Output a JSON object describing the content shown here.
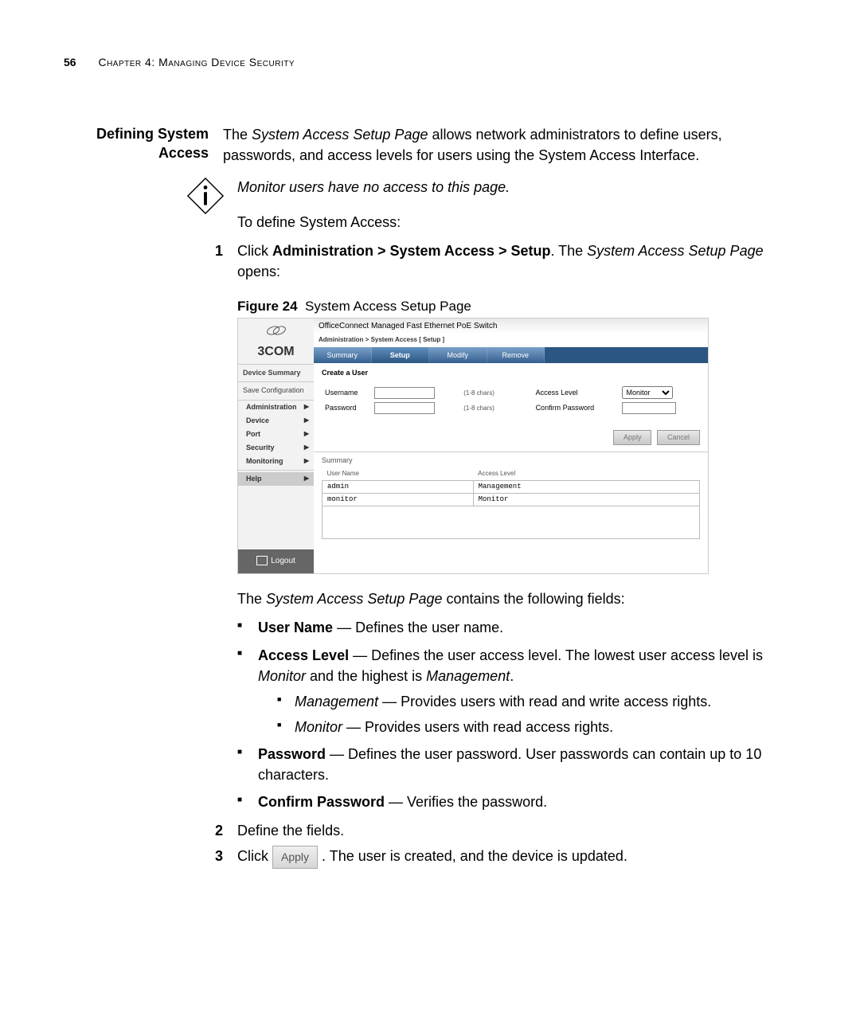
{
  "page": {
    "number": "56",
    "chapter": "Chapter 4: Managing Device Security"
  },
  "section_heading_l1": "Defining System",
  "section_heading_l2": "Access",
  "intro_text_1": "The ",
  "intro_em_1": "System Access Setup Page",
  "intro_text_2": " allows network administrators to define users, passwords, and access levels for users using the System Access Interface.",
  "note_text": "Monitor users have no access to this page.",
  "to_define": "To define System Access:",
  "step1_pre": "Click ",
  "step1_bold": "Administration > System Access > Setup",
  "step1_post": ". The ",
  "step1_em": "System Access Setup Page",
  "step1_end": " opens:",
  "figure_label": "Figure 24",
  "figure_title": "System Access Setup Page",
  "fig": {
    "brand": "3COM",
    "product": "OfficeConnect Managed Fast Ethernet PoE Switch",
    "breadcrumb": "Administration > System Access [ Setup ]",
    "sidebar": {
      "device_summary": "Device Summary",
      "save_config": "Save Configuration",
      "items": [
        "Administration",
        "Device",
        "Port",
        "Security",
        "Monitoring",
        "Help"
      ],
      "logout": "Logout"
    },
    "tabs": [
      "Summary",
      "Setup",
      "Modify",
      "Remove"
    ],
    "active_tab_index": 1,
    "form": {
      "section": "Create a User",
      "username_label": "Username",
      "username_hint": "(1-8 chars)",
      "password_label": "Password",
      "password_hint": "(1-8 chars)",
      "access_level_label": "Access Level",
      "access_level_value": "Monitor",
      "confirm_password_label": "Confirm Password",
      "apply": "Apply",
      "cancel": "Cancel"
    },
    "summary": {
      "heading": "Summary",
      "col_user": "User Name",
      "col_level": "Access Level",
      "rows": [
        {
          "user": "admin",
          "level": "Management"
        },
        {
          "user": "monitor",
          "level": "Monitor"
        }
      ]
    }
  },
  "after_fig_intro_1": "The ",
  "after_fig_intro_em": "System Access Setup Page",
  "after_fig_intro_2": " contains the following fields:",
  "bullets": {
    "user_name_b": "User Name",
    "user_name_rest": " — Defines the user name.",
    "access_level_b": "Access Level",
    "access_level_rest_1": " — Defines the user access level. The lowest user access level is ",
    "access_level_em1": "Monitor",
    "access_level_mid": " and the highest is ",
    "access_level_em2": "Management",
    "access_level_end": ".",
    "mgmt_em": "Management",
    "mgmt_rest": " — Provides users with read and write access rights.",
    "mon_em": "Monitor",
    "mon_rest": " — Provides users with read access rights.",
    "password_b": "Password",
    "password_rest": " — Defines the user password. User passwords can contain up to 10 characters.",
    "confirm_b": "Confirm Password",
    "confirm_rest": " — Verifies the password."
  },
  "step2": "Define the fields.",
  "step3_pre": "Click ",
  "step3_btn": "Apply",
  "step3_post": " . The user is created, and the device is updated."
}
